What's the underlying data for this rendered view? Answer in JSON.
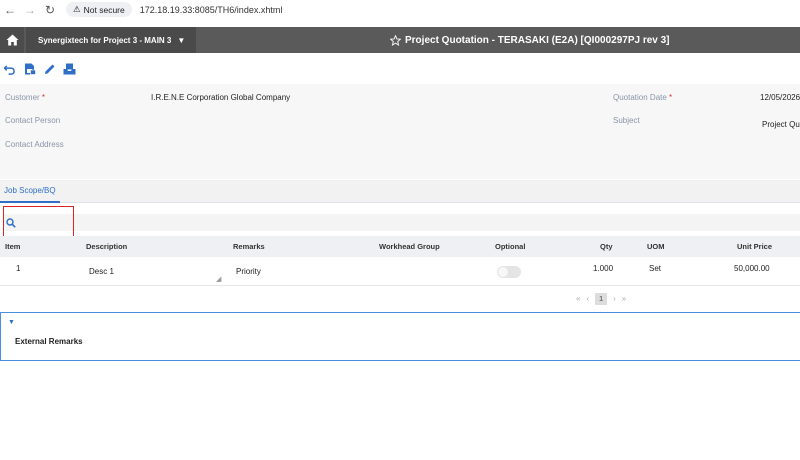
{
  "browser": {
    "back_icon": "arrow-left-icon",
    "forward_icon": "arrow-right-icon",
    "reload_icon": "reload-icon",
    "secure_label": "Not secure",
    "url": "172.18.19.33:8085/TH6/index.xhtml"
  },
  "header": {
    "project": "Synergixtech for Project 3 - MAIN 3",
    "title": "Project Quotation - TERASAKI (E2A) [QI000297PJ rev 3]"
  },
  "form": {
    "customer_label": "Customer",
    "customer_value": "I.R.E.N.E Corporation Global Company",
    "contact_person_label": "Contact Person",
    "contact_address_label": "Contact Address",
    "quotation_date_label": "Quotation Date",
    "quotation_date_value": "12/05/2026",
    "subject_label": "Subject",
    "subject_value": "Project Qu",
    "required_mark": "*"
  },
  "tabs": [
    {
      "label": "Job Scope/BQ",
      "active": true
    }
  ],
  "table": {
    "columns": [
      "Item",
      "Description",
      "Remarks",
      "Workhead Group",
      "Optional",
      "Qty",
      "UOM",
      "Unit Price"
    ],
    "rows": [
      {
        "item": "1",
        "description": "Desc 1",
        "remarks": "Priority",
        "workhead_group": "",
        "optional": false,
        "qty": "1.000",
        "uom": "Set",
        "unit_price": "50,000.00"
      }
    ]
  },
  "pager": {
    "first": "«",
    "prev": "‹",
    "current": "1",
    "next": "›",
    "last": "»"
  },
  "external_remarks": {
    "title": "External Remarks"
  },
  "colors": {
    "header_bg": "#5a5a5a",
    "accent_blue": "#2f6fc6",
    "highlight_red": "#d22222"
  }
}
